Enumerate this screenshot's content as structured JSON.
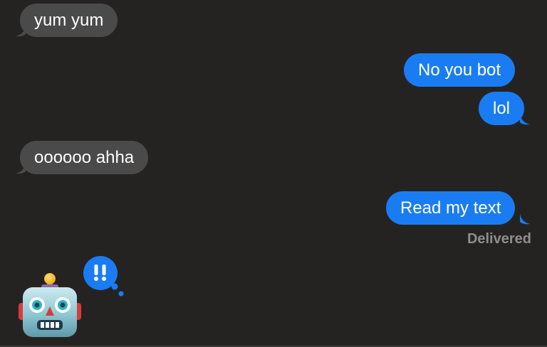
{
  "messages": [
    {
      "text": "yum yum",
      "from": "received"
    },
    {
      "text": "No you bot",
      "from": "sent"
    },
    {
      "text": "lol",
      "from": "sent"
    },
    {
      "text": "oooooo ahha",
      "from": "received"
    },
    {
      "text": "Read my text",
      "from": "sent"
    }
  ],
  "status": {
    "delivered": "Delivered"
  },
  "typing_indicator": {
    "icon": "double-exclamation-icon",
    "glyph": "‼"
  },
  "sender_avatar": {
    "icon": "robot-face-icon"
  },
  "colors": {
    "background": "#252322",
    "received_bubble": "#4b4a4a",
    "sent_bubble": "#1a7cf3",
    "status_text": "#8f8d8c"
  }
}
